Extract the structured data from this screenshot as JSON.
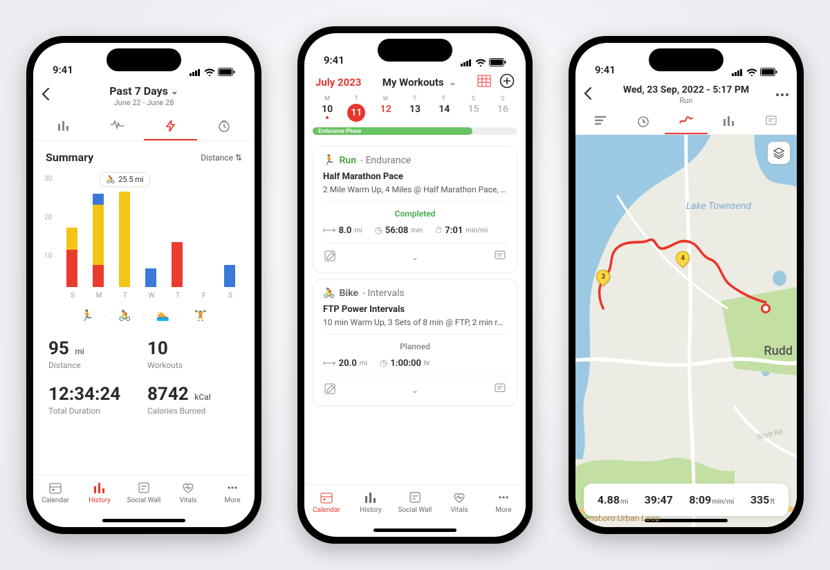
{
  "status_time": "9:41",
  "colors": {
    "accent": "#e8362d",
    "yellow": "#f5c516",
    "blue": "#3b78d8",
    "red": "#ea3b2f",
    "green_bar": "#68c362"
  },
  "phone1": {
    "header": {
      "title": "Past 7 Days",
      "subtitle": "June 22 - June 28"
    },
    "summary_label": "Summary",
    "sort_label": "Distance",
    "tooltip": "25.5 mi",
    "y_ticks": [
      "30",
      "20",
      "10"
    ],
    "x_labels": [
      "S",
      "M",
      "T",
      "W",
      "T",
      "F",
      "S"
    ],
    "sport_legend": [
      "run",
      "bike",
      "swim",
      "strength"
    ],
    "stats": {
      "distance_val": "95",
      "distance_unit": "mi",
      "distance_lbl": "Distance",
      "workouts_val": "10",
      "workouts_lbl": "Workouts",
      "duration_val": "12:34:24",
      "duration_lbl": "Total Duration",
      "cal_val": "8742",
      "cal_unit": "kCal",
      "cal_lbl": "Calories Burned"
    },
    "nav": {
      "calendar": "Calendar",
      "history": "History",
      "social": "Social Wall",
      "vitals": "Vitals",
      "more": "More"
    }
  },
  "phone2": {
    "month": "July 2023",
    "dropdown": "My Workouts",
    "dow": [
      "M",
      "T",
      "W",
      "T",
      "F",
      "S",
      "S"
    ],
    "days": [
      "10",
      "11",
      "12",
      "13",
      "14",
      "15",
      "16"
    ],
    "phase": "Endurance Phase",
    "phase_pct": 78,
    "cards": [
      {
        "sport": "Run",
        "type": "Endurance",
        "title": "Half Marathon Pace",
        "desc": "2 Mile Warm Up, 4 Miles @ Half Marathon Pace, 2...",
        "status": "Completed",
        "m_dist": "8.0",
        "m_dist_u": "mi",
        "m_time": "56:08",
        "m_time_u": "min",
        "m_pace": "7:01",
        "m_pace_u": "min/mi"
      },
      {
        "sport": "Bike",
        "type": "Intervals",
        "title": "FTP Power Intervals",
        "desc": "10 min Warm Up, 3 Sets of 8 min @ FTP, 2 min reco...",
        "status": "Planned",
        "m_dist": "20.0",
        "m_dist_u": "mi",
        "m_time": "1:00:00",
        "m_time_u": "hr"
      }
    ],
    "nav": {
      "calendar": "Calendar",
      "history": "History",
      "social": "Social Wall",
      "vitals": "Vitals",
      "more": "More"
    }
  },
  "phone3": {
    "header": {
      "title": "Wed, 23 Sep, 2022 - 5:17 PM",
      "subtitle": "Run"
    },
    "map": {
      "lake_label": "Lake Townsend",
      "rudd_label": "Rudd",
      "road_label": "Scott Rd",
      "loop_label": "ensboro Urban Loop",
      "markers": [
        {
          "n": "3"
        },
        {
          "n": "4"
        }
      ]
    },
    "stats": {
      "dist": "4.88",
      "dist_u": "mi",
      "time": "39:47",
      "pace": "8:09",
      "pace_u": "min/mi",
      "elev": "335",
      "elev_u": "ft"
    }
  },
  "chart_data": {
    "type": "bar",
    "stacked": true,
    "categories": [
      "S",
      "M",
      "T",
      "W",
      "T",
      "F",
      "S"
    ],
    "series": [
      {
        "name": "run",
        "color": "#ea3b2f",
        "values": [
          10,
          6,
          0,
          0,
          12,
          0,
          0
        ]
      },
      {
        "name": "bike",
        "color": "#f5c516",
        "values": [
          6,
          16,
          25.5,
          0,
          0,
          0,
          0
        ]
      },
      {
        "name": "swim",
        "color": "#3b78d8",
        "values": [
          0,
          3,
          0,
          5,
          0,
          0,
          6
        ]
      },
      {
        "name": "strength",
        "color": "#4caf50",
        "values": [
          0,
          0,
          0,
          0,
          0,
          0,
          0
        ]
      }
    ],
    "ylim": [
      0,
      30
    ],
    "ylabel": "",
    "title": "Summary",
    "tooltip": {
      "category": "T",
      "label": "25.5 mi"
    }
  }
}
